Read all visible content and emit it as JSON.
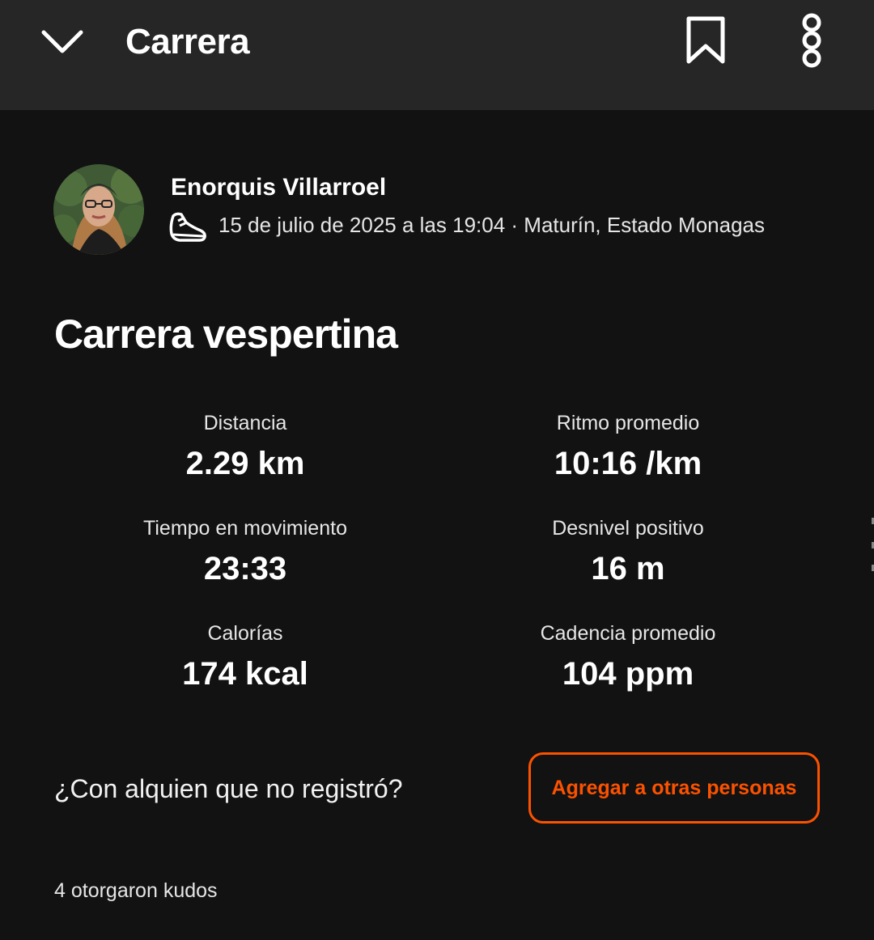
{
  "header": {
    "back_icon": "chevron-down-icon",
    "title": "Carrera",
    "bookmark_icon": "bookmark-icon",
    "more_icon": "more-vertical-icon"
  },
  "athlete": {
    "name": "Enorquis Villarroel",
    "activity_icon": "running-shoe-icon",
    "meta": "15 de julio de 2025 a las 19:04 · Maturín, Estado Monagas"
  },
  "activity": {
    "title": "Carrera vespertina"
  },
  "stats": [
    {
      "label": "Distancia",
      "value": "2.29 km"
    },
    {
      "label": "Ritmo promedio",
      "value": "10:16 /km"
    },
    {
      "label": "Tiempo en movimiento",
      "value": "23:33"
    },
    {
      "label": "Desnivel positivo",
      "value": "16 m"
    },
    {
      "label": "Calorías",
      "value": "174 kcal"
    },
    {
      "label": "Cadencia promedio",
      "value": "104 ppm"
    }
  ],
  "tag_prompt": {
    "text": "¿Con alquien que no registró?",
    "button_label": "Agregar a otras personas"
  },
  "kudos": {
    "text": "4 otorgaron kudos"
  },
  "colors": {
    "accent": "#fc5200",
    "background": "#121212",
    "topbar": "#262626",
    "text": "#ffffff"
  }
}
